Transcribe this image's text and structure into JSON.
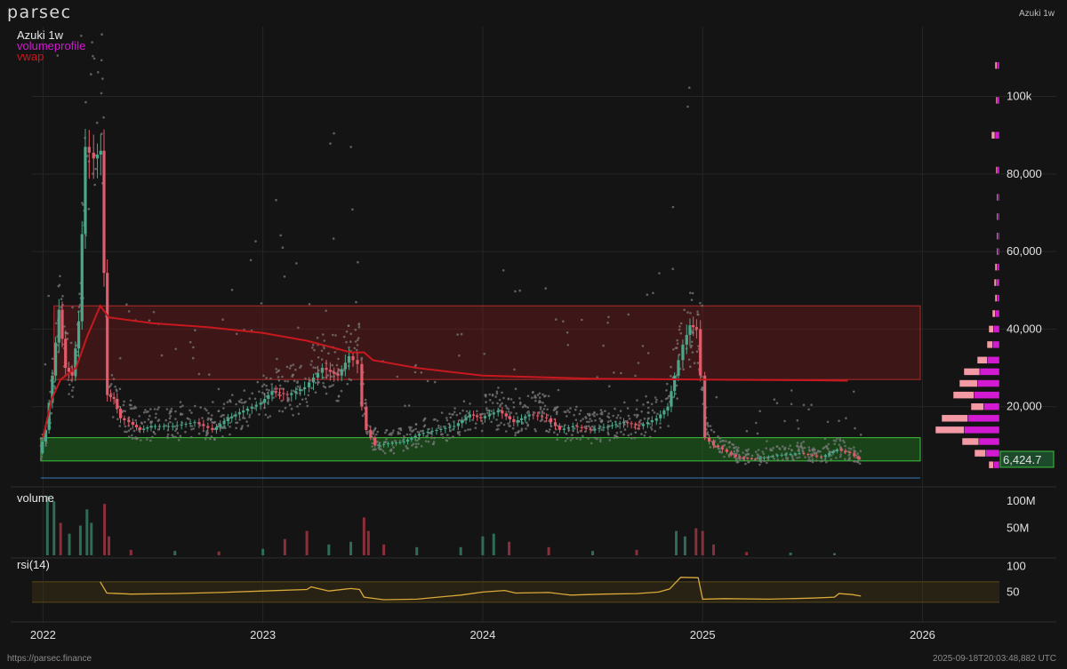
{
  "header": {
    "logo": "parsec",
    "right_title": "Azuki 1w"
  },
  "footer": {
    "url": "https://parsec.finance",
    "timestamp": "2025-09-18T20:03:48,882 UTC"
  },
  "colors": {
    "background": "#141414",
    "up": "#4aa88a",
    "down": "#e05b6b",
    "vwap": "#c8181f",
    "volumeprofile": "#d21ad2",
    "volumeprofile_light": "#f49aa4",
    "rsi": "#d9a93a",
    "support_zone": "#3ec23e",
    "resistance_zone": "#8a1d1d",
    "dots": "#7a7a7a"
  },
  "chart_data": [
    {
      "type": "candlestick",
      "pane": "price",
      "title": "Azuki 1w",
      "legend": [
        "volumeprofile",
        "vwap"
      ],
      "y_ticks": [
        20000,
        40000,
        60000,
        80000,
        100000
      ],
      "y_tick_labels": [
        "20,000",
        "40,000",
        "60,000",
        "80,000",
        "100k"
      ],
      "ylim": [
        0,
        118000
      ],
      "x_ticks": [
        "2022",
        "2023",
        "2024",
        "2025",
        "2026"
      ],
      "xlim": [
        2021.95,
        2026.35
      ],
      "last_price_label": "6,424.7",
      "last_price": 6424.7,
      "support_zone": {
        "x": [
          2021.99,
          2025.99
        ],
        "y": [
          6000,
          12000
        ]
      },
      "resistance_zone": {
        "x": [
          2022.05,
          2025.99
        ],
        "y": [
          27000,
          46000
        ]
      },
      "price_path": [
        [
          2021.99,
          8000
        ],
        [
          2022.02,
          14000
        ],
        [
          2022.05,
          28000
        ],
        [
          2022.08,
          45000
        ],
        [
          2022.11,
          30000
        ],
        [
          2022.14,
          28000
        ],
        [
          2022.17,
          42000
        ],
        [
          2022.2,
          87000
        ],
        [
          2022.24,
          84000
        ],
        [
          2022.27,
          86000
        ],
        [
          2022.3,
          23000
        ],
        [
          2022.33,
          22000
        ],
        [
          2022.36,
          17000
        ],
        [
          2022.4,
          16000
        ],
        [
          2022.45,
          14000
        ],
        [
          2022.5,
          15000
        ],
        [
          2022.6,
          15000
        ],
        [
          2022.7,
          16000
        ],
        [
          2022.78,
          14000
        ],
        [
          2022.85,
          17000
        ],
        [
          2022.92,
          19000
        ],
        [
          2023.0,
          21000
        ],
        [
          2023.05,
          24000
        ],
        [
          2023.12,
          23000
        ],
        [
          2023.2,
          25000
        ],
        [
          2023.28,
          30000
        ],
        [
          2023.35,
          28000
        ],
        [
          2023.4,
          33000
        ],
        [
          2023.44,
          31000
        ],
        [
          2023.46,
          20000
        ],
        [
          2023.48,
          14000
        ],
        [
          2023.52,
          10000
        ],
        [
          2023.58,
          10500
        ],
        [
          2023.65,
          11000
        ],
        [
          2023.72,
          13000
        ],
        [
          2023.8,
          14000
        ],
        [
          2023.88,
          15000
        ],
        [
          2023.95,
          18000
        ],
        [
          2024.0,
          17000
        ],
        [
          2024.08,
          19000
        ],
        [
          2024.15,
          16000
        ],
        [
          2024.22,
          18000
        ],
        [
          2024.3,
          17000
        ],
        [
          2024.36,
          14000
        ],
        [
          2024.42,
          15000
        ],
        [
          2024.5,
          14000
        ],
        [
          2024.58,
          15000
        ],
        [
          2024.65,
          16000
        ],
        [
          2024.72,
          15000
        ],
        [
          2024.8,
          17000
        ],
        [
          2024.85,
          20000
        ],
        [
          2024.88,
          28000
        ],
        [
          2024.92,
          36000
        ],
        [
          2024.95,
          41000
        ],
        [
          2024.98,
          40000
        ],
        [
          2025.0,
          28000
        ],
        [
          2025.02,
          12000
        ],
        [
          2025.06,
          10000
        ],
        [
          2025.1,
          9000
        ],
        [
          2025.16,
          7000
        ],
        [
          2025.25,
          6500
        ],
        [
          2025.35,
          7500
        ],
        [
          2025.45,
          8000
        ],
        [
          2025.55,
          7000
        ],
        [
          2025.62,
          9000
        ],
        [
          2025.68,
          8000
        ],
        [
          2025.72,
          6424.7
        ]
      ],
      "vwap_path": [
        [
          2022.0,
          12000
        ],
        [
          2022.04,
          22000
        ],
        [
          2022.08,
          27000
        ],
        [
          2022.15,
          30000
        ],
        [
          2022.2,
          38000
        ],
        [
          2022.26,
          46000
        ],
        [
          2022.3,
          43000
        ],
        [
          2022.5,
          41500
        ],
        [
          2022.75,
          40500
        ],
        [
          2023.0,
          39000
        ],
        [
          2023.2,
          37000
        ],
        [
          2023.4,
          34000
        ],
        [
          2023.46,
          34000
        ],
        [
          2023.5,
          32000
        ],
        [
          2023.7,
          30000
        ],
        [
          2024.0,
          28000
        ],
        [
          2024.5,
          27200
        ],
        [
          2025.0,
          27000
        ],
        [
          2025.5,
          26800
        ],
        [
          2025.66,
          26700
        ]
      ],
      "volume_profile": [
        {
          "price": 108000,
          "width": 5
        },
        {
          "price": 99000,
          "width": 4
        },
        {
          "price": 90000,
          "width": 9
        },
        {
          "price": 81000,
          "width": 4
        },
        {
          "price": 74000,
          "width": 3
        },
        {
          "price": 69000,
          "width": 3
        },
        {
          "price": 64000,
          "width": 3
        },
        {
          "price": 60000,
          "width": 3
        },
        {
          "price": 56000,
          "width": 5
        },
        {
          "price": 52000,
          "width": 6
        },
        {
          "price": 48000,
          "width": 5
        },
        {
          "price": 44000,
          "width": 8
        },
        {
          "price": 40000,
          "width": 12
        },
        {
          "price": 36000,
          "width": 14
        },
        {
          "price": 32000,
          "width": 25
        },
        {
          "price": 29000,
          "width": 40
        },
        {
          "price": 26000,
          "width": 45
        },
        {
          "price": 23000,
          "width": 52
        },
        {
          "price": 20000,
          "width": 32
        },
        {
          "price": 17000,
          "width": 65
        },
        {
          "price": 14000,
          "width": 72
        },
        {
          "price": 11000,
          "width": 42
        },
        {
          "price": 8000,
          "width": 28
        },
        {
          "price": 5000,
          "width": 12
        }
      ]
    },
    {
      "type": "bar",
      "pane": "volume",
      "title": "volume",
      "y_ticks": [
        50000000,
        100000000
      ],
      "y_tick_labels": [
        "50M",
        "100M"
      ],
      "ylim": [
        0,
        120000000
      ],
      "bars": [
        [
          2022.02,
          110000000,
          "up"
        ],
        [
          2022.05,
          100000000,
          "up"
        ],
        [
          2022.08,
          60000000,
          "down"
        ],
        [
          2022.12,
          40000000,
          "up"
        ],
        [
          2022.17,
          55000000,
          "up"
        ],
        [
          2022.2,
          85000000,
          "up"
        ],
        [
          2022.22,
          60000000,
          "up"
        ],
        [
          2022.28,
          95000000,
          "down"
        ],
        [
          2022.3,
          35000000,
          "down"
        ],
        [
          2022.4,
          10000000,
          "down"
        ],
        [
          2022.6,
          8000000,
          "up"
        ],
        [
          2022.8,
          7000000,
          "down"
        ],
        [
          2023.0,
          12000000,
          "up"
        ],
        [
          2023.1,
          30000000,
          "down"
        ],
        [
          2023.2,
          45000000,
          "down"
        ],
        [
          2023.3,
          20000000,
          "up"
        ],
        [
          2023.4,
          25000000,
          "up"
        ],
        [
          2023.46,
          70000000,
          "down"
        ],
        [
          2023.48,
          45000000,
          "down"
        ],
        [
          2023.55,
          20000000,
          "down"
        ],
        [
          2023.7,
          15000000,
          "up"
        ],
        [
          2023.9,
          15000000,
          "up"
        ],
        [
          2024.0,
          35000000,
          "up"
        ],
        [
          2024.05,
          40000000,
          "up"
        ],
        [
          2024.12,
          25000000,
          "down"
        ],
        [
          2024.3,
          15000000,
          "down"
        ],
        [
          2024.5,
          8000000,
          "up"
        ],
        [
          2024.7,
          10000000,
          "down"
        ],
        [
          2024.88,
          45000000,
          "up"
        ],
        [
          2024.92,
          35000000,
          "up"
        ],
        [
          2024.97,
          50000000,
          "down"
        ],
        [
          2025.0,
          45000000,
          "down"
        ],
        [
          2025.05,
          20000000,
          "down"
        ],
        [
          2025.2,
          6000000,
          "down"
        ],
        [
          2025.4,
          5000000,
          "up"
        ],
        [
          2025.6,
          4000000,
          "up"
        ]
      ]
    },
    {
      "type": "line",
      "pane": "rsi",
      "title": "rsi(14)",
      "y_ticks": [
        50,
        100
      ],
      "y_tick_labels": [
        "50",
        "100"
      ],
      "ylim": [
        0,
        110
      ],
      "band": [
        30,
        70
      ],
      "series": [
        [
          2022.26,
          70
        ],
        [
          2022.29,
          48
        ],
        [
          2022.4,
          46
        ],
        [
          2022.6,
          47
        ],
        [
          2022.8,
          49
        ],
        [
          2023.0,
          52
        ],
        [
          2023.2,
          55
        ],
        [
          2023.22,
          60
        ],
        [
          2023.3,
          52
        ],
        [
          2023.4,
          57
        ],
        [
          2023.44,
          55
        ],
        [
          2023.46,
          40
        ],
        [
          2023.55,
          35
        ],
        [
          2023.7,
          36
        ],
        [
          2023.9,
          44
        ],
        [
          2024.0,
          50
        ],
        [
          2024.1,
          53
        ],
        [
          2024.15,
          48
        ],
        [
          2024.3,
          49
        ],
        [
          2024.4,
          44
        ],
        [
          2024.55,
          46
        ],
        [
          2024.7,
          47
        ],
        [
          2024.8,
          50
        ],
        [
          2024.85,
          56
        ],
        [
          2024.9,
          79
        ],
        [
          2024.98,
          78
        ],
        [
          2025.0,
          36
        ],
        [
          2025.1,
          37
        ],
        [
          2025.3,
          36
        ],
        [
          2025.5,
          38
        ],
        [
          2025.6,
          40
        ],
        [
          2025.62,
          47
        ],
        [
          2025.68,
          45
        ],
        [
          2025.72,
          42
        ]
      ]
    }
  ]
}
